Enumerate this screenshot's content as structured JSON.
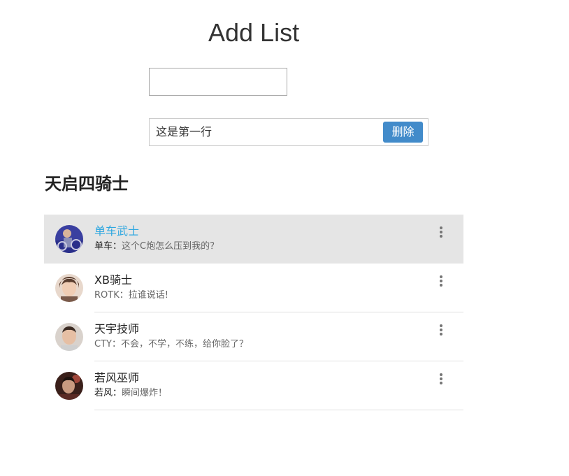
{
  "header": {
    "title": "Add List"
  },
  "add_form": {
    "input_value": "",
    "input_placeholder": ""
  },
  "todos": [
    {
      "text": "这是第一行",
      "delete_label": "删除"
    }
  ],
  "group": {
    "title": "天启四骑士"
  },
  "contacts": [
    {
      "name": "单车武士",
      "sender": "单车：",
      "message": "这个C炮怎么压到我的？",
      "selected": true,
      "avatar": "avatar-cyclist"
    },
    {
      "name": "XB骑士",
      "sender": "ROTK：",
      "message": "拉谁说话!",
      "selected": false,
      "avatar": "avatar-xb"
    },
    {
      "name": "天宇技师",
      "sender": "CTY：",
      "message": "不会，不学，不练，给你脸了？",
      "selected": false,
      "avatar": "avatar-cty"
    },
    {
      "name": "若风巫师",
      "sender": "若风：",
      "message": "瞬间爆炸！",
      "selected": false,
      "avatar": "avatar-ruofeng"
    }
  ],
  "colors": {
    "accent": "#428bca",
    "selected_name": "#2ea7e0",
    "selected_bg": "#e5e5e5"
  },
  "icons": {
    "more": "more-vert-icon"
  }
}
